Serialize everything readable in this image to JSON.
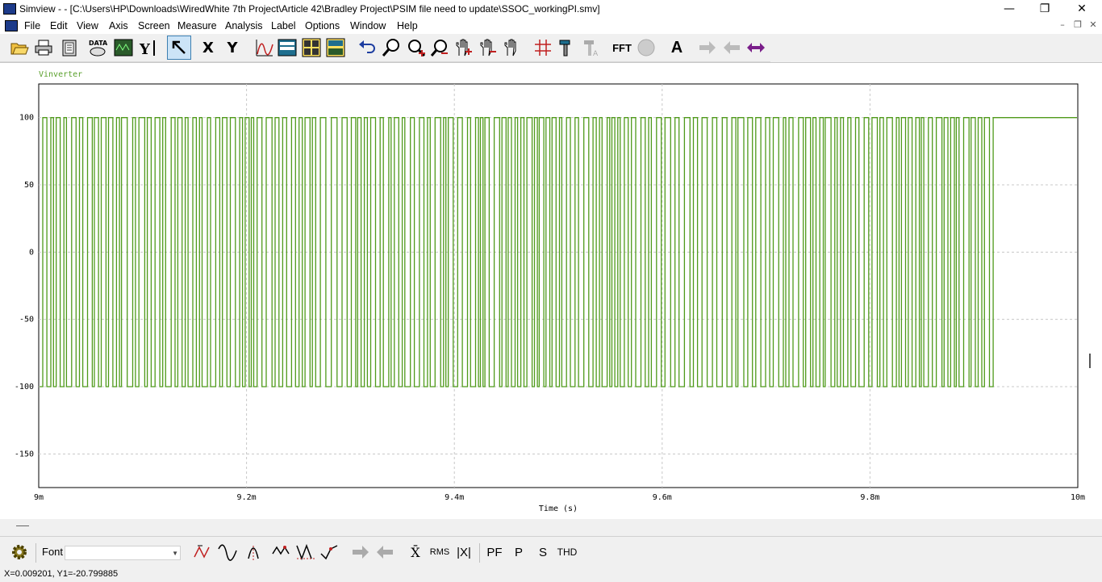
{
  "window": {
    "title": "Simview - - [C:\\Users\\HP\\Downloads\\WiredWhite 7th Project\\Article 42\\Bradley Project\\PSIM file need to update\\SSOC_workingPI.smv]",
    "minimize": "—",
    "restore": "❐",
    "close": "✕"
  },
  "menu": {
    "items": [
      "File",
      "Edit",
      "View",
      "Axis",
      "Screen",
      "Measure",
      "Analysis",
      "Label",
      "Options",
      "Window",
      "Help"
    ]
  },
  "toolbar": {
    "data_icon_text": "DATA",
    "x_label": "X",
    "y_label": "Y",
    "fft_label": "FFT",
    "text_label": "A"
  },
  "bottombar": {
    "font_label": "Font",
    "font_value": "",
    "rms_label": "RMS",
    "absx_label": "|X|",
    "pf_label": "PF",
    "p_label": "P",
    "s_label": "S",
    "thd_label": "THD",
    "xbar_label": "X̄"
  },
  "status": {
    "text": "X=0.009201, Y1=-20.799885"
  },
  "colors": {
    "trace": "#4f9a1a",
    "legend": "#5aa02c",
    "grid": "#c8c8c8"
  },
  "chart_data": {
    "type": "line",
    "series": [
      {
        "name": "Vinverter",
        "high": 100,
        "low": -100,
        "switching_events_approx": 250
      }
    ],
    "xlabel": "Time (s)",
    "x_ticks": [
      "9m",
      "9.2m",
      "9.4m",
      "9.6m",
      "9.8m",
      "10m"
    ],
    "x_tick_values": [
      0.009,
      0.0092,
      0.0094,
      0.0096,
      0.0098,
      0.01
    ],
    "y_ticks": [
      "100",
      "50",
      "0",
      "-50",
      "-100",
      "-150"
    ],
    "y_tick_values": [
      100,
      50,
      0,
      -50,
      -100,
      -150
    ],
    "xlim": [
      0.009,
      0.01
    ],
    "ylim": [
      -175,
      125
    ],
    "grid": true
  }
}
